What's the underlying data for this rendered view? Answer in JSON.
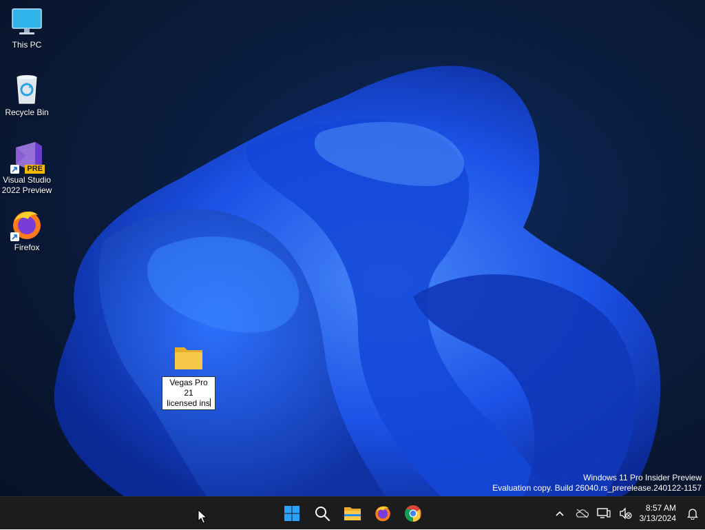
{
  "desktop": {
    "icons": [
      {
        "label_line1": "This PC",
        "label_line2": "",
        "icon": "monitor-icon"
      },
      {
        "label_line1": "Recycle Bin",
        "label_line2": "",
        "icon": "recycle-bin-icon"
      },
      {
        "label_line1": "Visual Studio",
        "label_line2": "2022 Preview",
        "icon": "visual-studio-preview-icon",
        "badge": "PRE"
      },
      {
        "label_line1": "Firefox",
        "label_line2": "",
        "icon": "firefox-icon"
      }
    ],
    "renaming_folder": {
      "icon": "folder-icon",
      "text_line1": "Vegas Pro 21",
      "text_line2": "licensed ins"
    }
  },
  "watermark": {
    "line1": "Windows 11 Pro Insider Preview",
    "line2": "Evaluation copy. Build 26040.rs_prerelease.240122-1157"
  },
  "taskbar": {
    "pinned": [
      "start-icon",
      "search-icon",
      "file-explorer-icon",
      "firefox-icon",
      "chrome-icon"
    ],
    "tray": [
      "chevron-up-icon",
      "onedrive-icon",
      "network-icon",
      "volume-muted-icon"
    ],
    "clock": {
      "time": "8:57 AM",
      "date": "3/13/2024"
    },
    "notification_icon": "bell-icon"
  },
  "colors": {
    "taskbar_bg": "#1c1c1c",
    "wallpaper_blue": "#1f5cff",
    "wallpaper_bg": "#0a1c3d",
    "start_blue": "#29a3ff",
    "folder_yellow": "#f7c948"
  }
}
